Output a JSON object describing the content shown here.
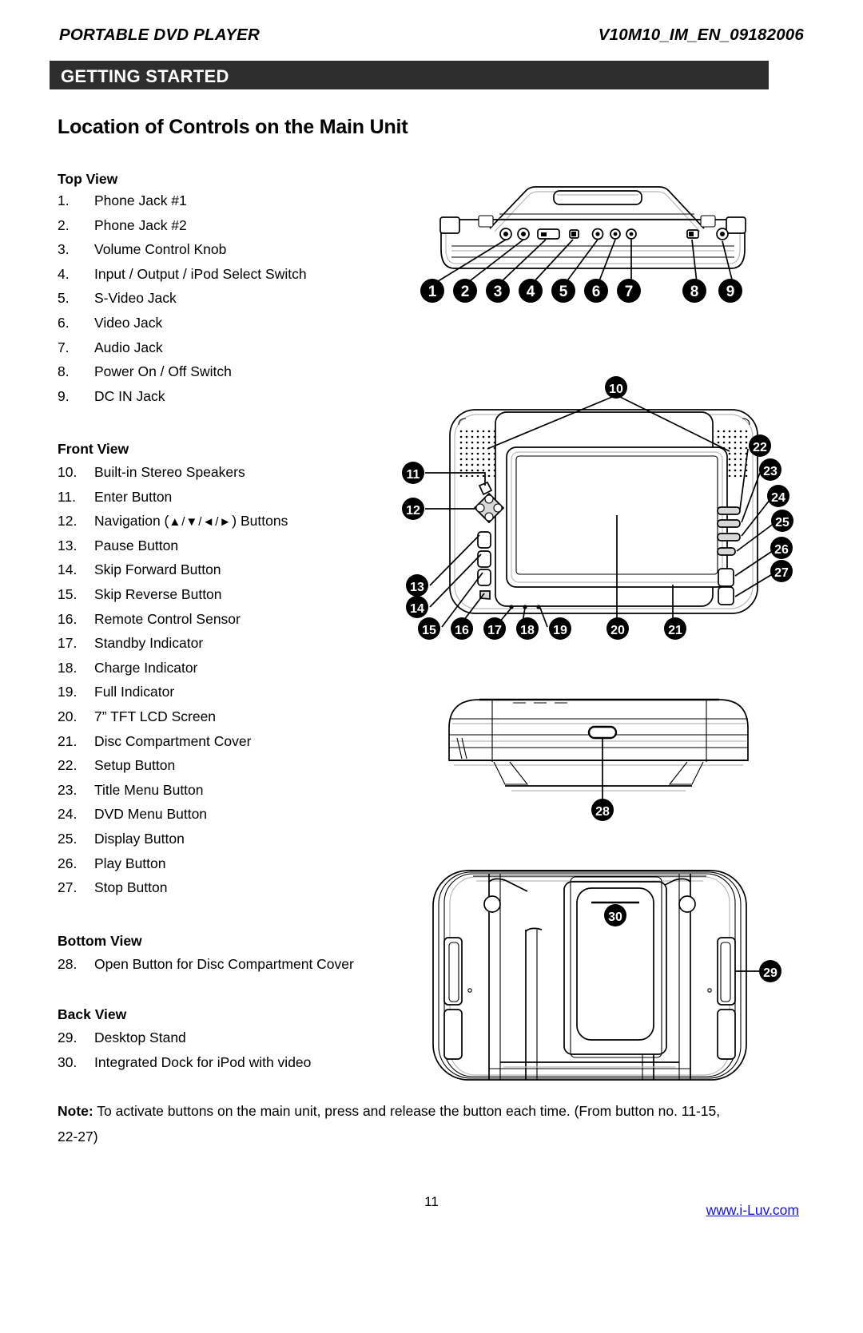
{
  "header": {
    "left_title": "PORTABLE DVD PLAYER",
    "right_code": "V10M10_IM_EN_09182006",
    "banner": "GETTING STARTED"
  },
  "page_title": "Location of Controls on the Main Unit",
  "sections": [
    {
      "heading": "Top View",
      "items": [
        {
          "num": "1.",
          "label": "Phone Jack #1"
        },
        {
          "num": "2.",
          "label": "Phone Jack #2"
        },
        {
          "num": "3.",
          "label": "Volume Control Knob"
        },
        {
          "num": "4.",
          "label": "Input / Output / iPod Select Switch"
        },
        {
          "num": "5.",
          "label": "S-Video Jack"
        },
        {
          "num": "6.",
          "label": "Video Jack"
        },
        {
          "num": "7.",
          "label": "Audio Jack"
        },
        {
          "num": "8.",
          "label": "Power On / Off Switch"
        },
        {
          "num": "9.",
          "label": "DC IN Jack"
        }
      ]
    },
    {
      "heading": "Front View",
      "items": [
        {
          "num": "10.",
          "label": "Built-in Stereo Speakers"
        },
        {
          "num": "11.",
          "label": "Enter Button"
        },
        {
          "num": "12.",
          "label": "Navigation (▲/▼/◄/►) Buttons"
        },
        {
          "num": "13.",
          "label": "Pause Button"
        },
        {
          "num": "14.",
          "label": "Skip Forward Button"
        },
        {
          "num": "15.",
          "label": "Skip Reverse Button"
        },
        {
          "num": "16.",
          "label": "Remote Control Sensor"
        },
        {
          "num": "17.",
          "label": "Standby Indicator"
        },
        {
          "num": "18.",
          "label": "Charge Indicator"
        },
        {
          "num": "19.",
          "label": "Full Indicator"
        },
        {
          "num": "20.",
          "label": "7” TFT LCD Screen"
        },
        {
          "num": "21.",
          "label": "Disc Compartment Cover"
        },
        {
          "num": "22.",
          "label": "Setup Button"
        },
        {
          "num": "23.",
          "label": "Title Menu Button"
        },
        {
          "num": "24.",
          "label": "DVD Menu Button"
        },
        {
          "num": "25.",
          "label": "Display Button"
        },
        {
          "num": "26.",
          "label": "Play Button"
        },
        {
          "num": "27.",
          "label": "Stop Button"
        }
      ]
    },
    {
      "heading": "Bottom View",
      "items": [
        {
          "num": "28.",
          "label": "Open Button for Disc Compartment Cover"
        }
      ]
    },
    {
      "heading": "Back View",
      "items": [
        {
          "num": "29.",
          "label": "Desktop Stand"
        },
        {
          "num": "30.",
          "label": "Integrated Dock for iPod with video"
        }
      ]
    }
  ],
  "note": {
    "label": "Note:",
    "text": " To activate buttons on the main unit, press and release the button each time. (From button no. 11-15, 22-27)"
  },
  "footer": {
    "page_number": "11",
    "website": "www.i-Luv.com"
  },
  "figures": {
    "top_view": {
      "callouts": [
        "1",
        "2",
        "3",
        "4",
        "5",
        "6",
        "7",
        "8",
        "9"
      ]
    },
    "front_view": {
      "callouts_top": [
        "10"
      ],
      "callouts_left": [
        "11",
        "12",
        "13",
        "14"
      ],
      "callouts_bottom": [
        "15",
        "16",
        "17",
        "18",
        "19",
        "20",
        "21"
      ],
      "callouts_right": [
        "22",
        "23",
        "24",
        "25",
        "26",
        "27"
      ]
    },
    "bottom_view": {
      "callouts": [
        "28"
      ]
    },
    "back_view": {
      "callouts": [
        "29",
        "30"
      ]
    }
  },
  "colors": {
    "banner_bg": "#2e2e2e",
    "banner_text": "#ffffff",
    "link": "#1414d2",
    "body_text": "#000000"
  }
}
